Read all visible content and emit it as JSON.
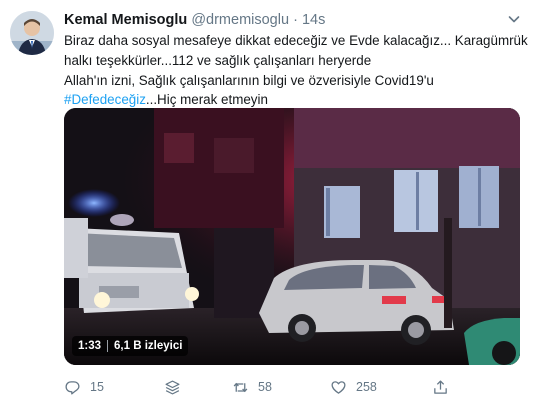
{
  "tweet": {
    "author_name": "Kemal Memisoglu",
    "handle": "@drmemisoglu",
    "separator": "·",
    "time": "14s",
    "lines": [
      "Biraz daha sosyal mesafeye dikkat edeceğiz ve Evde kalacağız... Karagümrük",
      "halkı teşekkürler...112 ve sağlık çalışanları heryerde",
      "Allah'ın izni, Sağlık çalışanlarının bilgi ve özverisiyle Covid19'u"
    ],
    "hashtag": "#Defedeceğiz",
    "after_hashtag": "...Hiç merak etmeyin"
  },
  "video": {
    "duration": "1:33",
    "views": "6,1 B izleyici"
  },
  "actions": {
    "reply_count": "15",
    "retweet_count": "58",
    "like_count": "258"
  },
  "icons": {
    "caret": "chevron-down-icon",
    "reply": "reply-icon",
    "stack": "thread-stack-icon",
    "retweet": "retweet-icon",
    "like": "heart-icon",
    "share": "share-icon"
  },
  "colors": {
    "link": "#1da1f2",
    "secondary_text": "#657786"
  }
}
